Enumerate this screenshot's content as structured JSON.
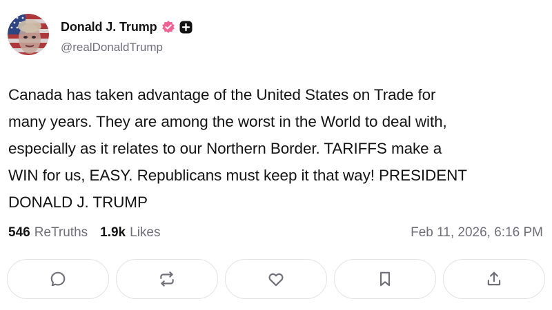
{
  "author": {
    "display_name": "Donald J. Trump",
    "handle": "@realDonaldTrump",
    "verified_badge_color": "#f06292",
    "plus_badge_color": "#141414"
  },
  "post": {
    "text_lines": [
      "Canada has taken advantage of the United States on Trade for",
      "many years. They are among the worst in the World to deal with,",
      "especially as it relates to our Northern Border. TARIFFS make a",
      "WIN for us, EASY. Republicans must keep it that way! PRESIDENT",
      "DONALD J. TRUMP"
    ]
  },
  "stats": {
    "retruths_count": "546",
    "retruths_label": "ReTruths",
    "likes_count": "1.9k",
    "likes_label": "Likes",
    "timestamp": "Feb 11, 2026, 6:16 PM"
  },
  "actions": [
    {
      "name": "reply-button",
      "icon": "comment-icon"
    },
    {
      "name": "retruth-button",
      "icon": "repost-icon"
    },
    {
      "name": "like-button",
      "icon": "heart-icon"
    },
    {
      "name": "bookmark-button",
      "icon": "bookmark-icon"
    },
    {
      "name": "share-button",
      "icon": "share-icon"
    }
  ],
  "colors": {
    "text": "#141414",
    "muted": "#6f6f78",
    "border": "#e3e3e6"
  }
}
